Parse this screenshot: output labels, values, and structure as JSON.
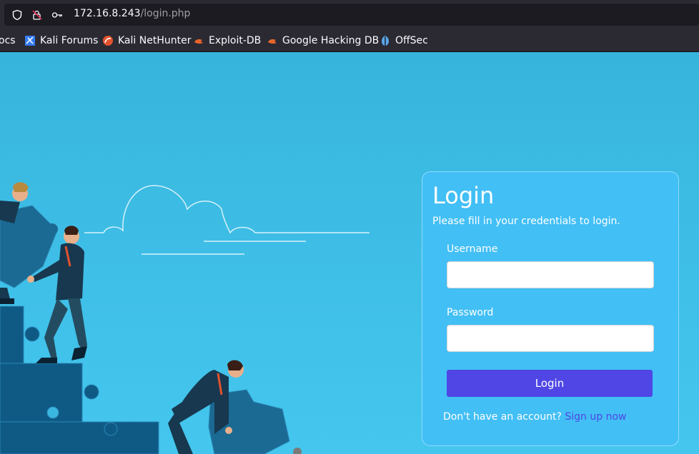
{
  "browser": {
    "url_host": "172.16.8.243",
    "url_path": "/login.php"
  },
  "bookmarks": [
    {
      "label": "ocs",
      "icon": "docs-icon"
    },
    {
      "label": "Kali Forums",
      "icon": "kali-forums-icon"
    },
    {
      "label": "Kali NetHunter",
      "icon": "kali-nethunter-icon"
    },
    {
      "label": "Exploit-DB",
      "icon": "exploit-db-icon"
    },
    {
      "label": "Google Hacking DB",
      "icon": "ghdb-icon"
    },
    {
      "label": "OffSec",
      "icon": "offsec-icon"
    }
  ],
  "login": {
    "title": "Login",
    "subtitle": "Please fill in your credentials to login.",
    "username_label": "Username",
    "username_value": "",
    "password_label": "Password",
    "password_value": "",
    "submit_label": "Login",
    "signup_prompt": "Don't have an account?",
    "signup_link": "Sign up now"
  },
  "colors": {
    "background": "#3fc0e8",
    "card": "#42bff5",
    "accent": "#4f46e5"
  }
}
